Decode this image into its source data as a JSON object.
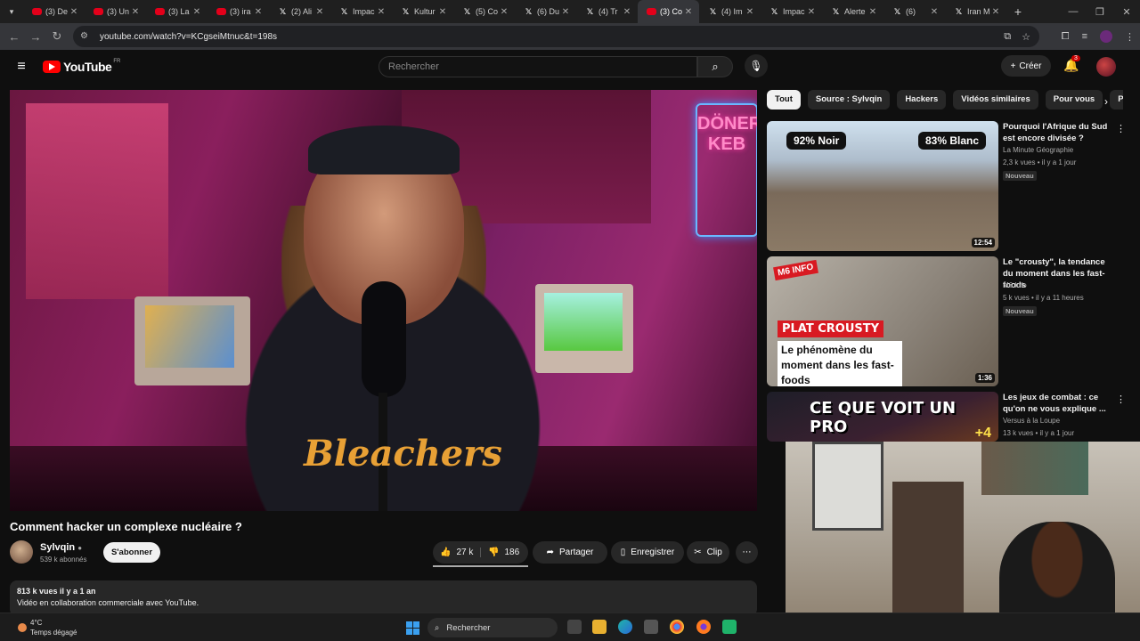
{
  "browser": {
    "tabs": [
      {
        "label": "(3) De",
        "icon": "youtube-icon"
      },
      {
        "label": "(3) Un",
        "icon": "youtube-icon"
      },
      {
        "label": "(3) La",
        "icon": "youtube-icon"
      },
      {
        "label": "(3) ira",
        "icon": "youtube-icon"
      },
      {
        "label": "(2) Ali",
        "icon": "x-icon"
      },
      {
        "label": "Impac",
        "icon": "x-icon"
      },
      {
        "label": "Kultur",
        "icon": "x-icon"
      },
      {
        "label": "(5) Co",
        "icon": "x-icon"
      },
      {
        "label": "(6) Du",
        "icon": "x-icon"
      },
      {
        "label": "(4) Tr",
        "icon": "x-icon"
      },
      {
        "label": "(3) Co",
        "icon": "youtube-icon",
        "active": true
      },
      {
        "label": "(4) Im",
        "icon": "x-icon"
      },
      {
        "label": "Impac",
        "icon": "x-icon"
      },
      {
        "label": "Alerte",
        "icon": "x-icon"
      },
      {
        "label": "(6)",
        "icon": "x-icon"
      },
      {
        "label": "Iran M",
        "icon": "x-icon"
      }
    ],
    "url": "youtube.com/watch?v=KCgseiMtnuc&t=198s"
  },
  "youtube": {
    "logo_text": "YouTube",
    "country_code": "FR",
    "search_placeholder": "Rechercher",
    "create_label": "Créer",
    "notif_count": "3"
  },
  "video": {
    "title": "Comment hacker un complexe nucléaire ?",
    "channel": "Sylvqin",
    "subscribers": "539 k abonnés",
    "subscribe_label": "S'abonner",
    "likes": "27 k",
    "dislikes": "186",
    "share_label": "Partager",
    "save_label": "Enregistrer",
    "clip_label": "Clip",
    "shirt_text": "Bleachers",
    "neon_text": "DÖNER KEB",
    "description": {
      "meta": "813 k vues  il y a 1 an",
      "line1": "Vidéo en collaboration commerciale avec YouTube."
    }
  },
  "chips": [
    "Tout",
    "Source : Sylvqin",
    "Hackers",
    "Vidéos similaires",
    "Pour vous",
    "Pub"
  ],
  "recommendations": [
    {
      "title": "Pourquoi l'Afrique du Sud est encore divisée ?",
      "channel": "La Minute Géographie",
      "meta": "2,3 k vues • il y a 1 jour",
      "badge": "Nouveau",
      "duration": "12:54",
      "thumb_labels": [
        "92% Noir",
        "83% Blanc"
      ]
    },
    {
      "title": "Le \"crousty\", la tendance du moment dans les fast-foods",
      "channel": "M6 Info",
      "meta": "5 k vues • il y a 11 heures",
      "badge": "Nouveau",
      "duration": "1:36",
      "thumb_labels": [
        "PLAT CROUSTY",
        "Le phénomène du moment dans les fast-foods",
        "M6 INFO"
      ]
    },
    {
      "title": "Les jeux de combat : ce qu'on ne vous explique ...",
      "channel": "Versus à la Loupe",
      "meta": "13 k vues • il y a 1 jour",
      "thumb_labels": [
        "CE QUE VOIT UN PRO",
        "+4"
      ]
    }
  ],
  "taskbar": {
    "temperature": "4°C",
    "weather": "Temps dégagé",
    "search_label": "Rechercher"
  }
}
